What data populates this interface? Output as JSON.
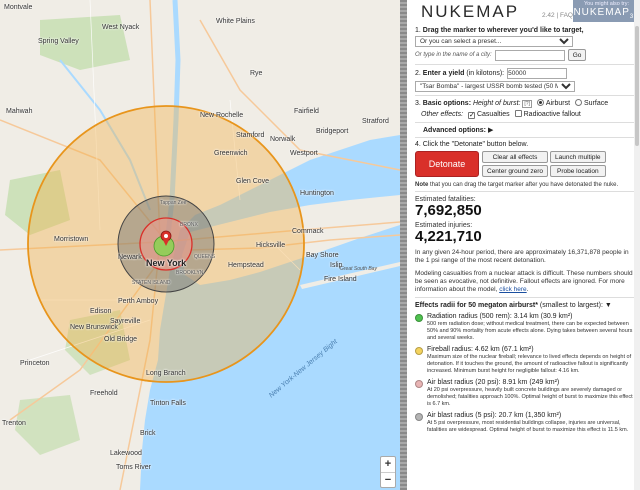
{
  "header": {
    "logo": "NUKEMAP",
    "version": "2.42",
    "sep": "|",
    "faq": "FAQ",
    "also_might": "You might also try:",
    "also_name": "NUKEMAP",
    "also_sub": "3D"
  },
  "step1": {
    "num": "1.",
    "title": "Drag the marker to wherever you'd like to target,",
    "preset": "Or you can select a preset...",
    "city_label": "Or type in the name of a city:",
    "city_value": "",
    "go": "Go"
  },
  "step2": {
    "num": "2.",
    "title": "Enter a yield",
    "title_rest": "(in kilotons):",
    "yield_value": "50000",
    "preset": "\"Tsar Bomba\" - largest USSR bomb tested (50 Mt)"
  },
  "step3": {
    "num": "3.",
    "title": "Basic options:",
    "height_label": "Height of burst:",
    "help": "[?]",
    "airburst": "Airburst",
    "surface": "Surface",
    "other_effects": "Other effects:",
    "casualties": "Casualties",
    "fallout": "Radioactive fallout"
  },
  "advanced": {
    "label": "Advanced options:",
    "arrow": "▶"
  },
  "step4": {
    "num": "4.",
    "title_pre": "Click the \"Detonate\" button below.",
    "detonate": "Detonate",
    "clear": "Clear all effects",
    "launch": "Launch multiple",
    "center": "Center ground zero",
    "probe": "Probe location",
    "note_bold": "Note",
    "note": " that you can drag the target marker after you have detonated the nuke."
  },
  "results": {
    "fatalities_label": "Estimated fatalities:",
    "fatalities": "7,692,850",
    "injuries_label": "Estimated injuries:",
    "injuries": "4,221,710",
    "para1": "In any given 24-hour period, there are approximately 16,371,878 people in the 1 psi range of the most recent detonation.",
    "para2_pre": "Modeling casualties from a nuclear attack is difficult. These numbers should be seen as evocative, not definitive. Fallout effects are ignored. For more information about the model,",
    "para2_link": "click here",
    "para2_post": "."
  },
  "radii": {
    "title": "Effects radii for 50 megaton airburst*",
    "title_rest": "(smallest to largest):",
    "arrow": "▼",
    "items": [
      {
        "color": "#4fc24f",
        "title": "Radiation radius (500 rem): 3.14 km (30.9 km²)",
        "desc": "500 rem radiation dose; without medical treatment, there can be expected between 50% and 90% mortality from acute effects alone. Dying takes between several hours and several weeks."
      },
      {
        "color": "#f4d35e",
        "title": "Fireball radius: 4.62 km (67.1 km²)",
        "desc": "Maximum size of the nuclear fireball; relevance to lived effects depends on height of detonation. If it touches the ground, the amount of radioactive fallout is significantly increased. Minimum burst height for negligible fallout: 4.16 km."
      },
      {
        "color": "#e8b4b4",
        "title": "Air blast radius (20 psi): 8.91 km (249 km²)",
        "desc": "At 20 psi overpressure, heavily built concrete buildings are severely damaged or demolished; fatalities approach 100%. Optimal height of burst to maximize this effect is 6.7 km."
      },
      {
        "color": "#b4b4b4",
        "title": "Air blast radius (5 psi): 20.7 km (1,350 km²)",
        "desc": "At 5 psi overpressure, most residential buildings collapse, injuries are universal, fatalities are widespread. Optimal height of burst to maximize this effect is 11.5 km."
      }
    ]
  },
  "map": {
    "labels": {
      "montvale": "Montvale",
      "westnyack": "West Nyack",
      "spring": "Spring Valley",
      "elmsford": "Elmsford",
      "rye": "Rye",
      "mahwah": "Mahwah",
      "newrochelle": "New Rochelle",
      "glencove": "Glen Cove",
      "huntington": "Huntington",
      "bridgeport": "Bridgeport",
      "stratford": "Stratford",
      "fairfield": "Fairfield",
      "westport": "Westport",
      "norwalk": "Norwalk",
      "stamford": "Stamford",
      "greenwich": "Greenwich",
      "morristown": "Morristown",
      "newark": "Newark",
      "newyork": "New York",
      "hempstead": "Hempstead",
      "hicksville": "Hicksville",
      "commack": "Commack",
      "islip": "Islip",
      "bayshore": "Bay Shore",
      "fireisland": "Fire Island",
      "southbay": "Great South Bay",
      "edison": "Edison",
      "perthamboy": "Perth Amboy",
      "newbrunswick": "New Brunswick",
      "oldbridge": "Old Bridge",
      "sayreville": "Sayreville",
      "princeton": "Princeton",
      "trenton": "Trenton",
      "freehold": "Freehold",
      "lakewood": "Lakewood",
      "tomsriver": "Toms River",
      "longbranch": "Long Branch",
      "brick": "Brick",
      "tinton": "Tinton Falls",
      "bight": "New York-New Jersey Bight",
      "tz": "Tappan Zee",
      "whiteplains": "White Plains",
      "bronx": "BRONX",
      "queens": "QUEENS",
      "brooklyn": "BROOKLYN",
      "si": "STATEN ISLAND"
    },
    "zoom_in": "+",
    "zoom_out": "−"
  }
}
